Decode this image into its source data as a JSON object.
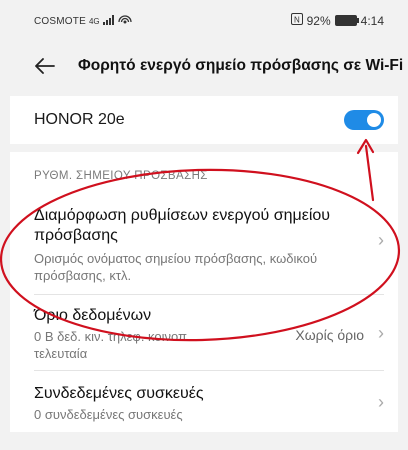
{
  "status": {
    "carrier": "COSMOTE",
    "network": "4G",
    "battery": "92%",
    "time": "4:14"
  },
  "header": {
    "title": "Φορητό ενεργό σημείο πρόσβασης σε Wi-Fi"
  },
  "hotspot": {
    "name": "HONOR 20e",
    "enabled": true
  },
  "section": {
    "title": "ΡΥΘΜ. ΣΗΜΕΙΟΥ ΠΡΟΣΒΑΣΗΣ"
  },
  "items": [
    {
      "title": "Διαμόρφωση ρυθμίσεων ενεργού σημείου πρόσβασης",
      "subtitle": "Ορισμός ονόματος σημείου πρόσβασης, κωδικού πρόσβασης, κτλ."
    },
    {
      "title": "Όριο δεδομένων",
      "subtitle": "0 B δεδ. κιν. τηλεφ. κοινοπ. τελευταία",
      "value": "Χωρίς όριο"
    },
    {
      "title": "Συνδεδεμένες συσκευές",
      "subtitle": "0 συνδεδεμένες συσκευές"
    }
  ],
  "colors": {
    "accent": "#1f8be6",
    "annotation": "#d0101e"
  }
}
